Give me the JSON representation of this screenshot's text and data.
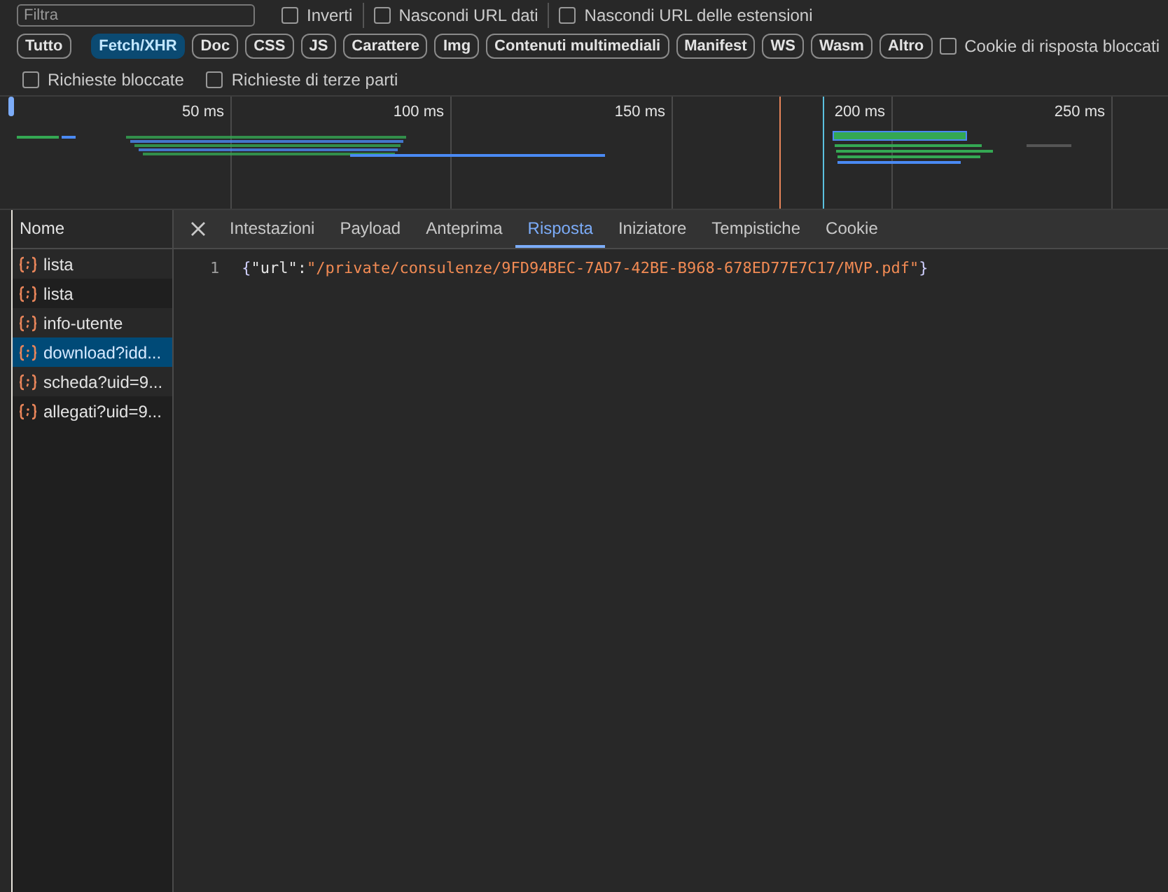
{
  "filter": {
    "placeholder": "Filtra"
  },
  "options_top": [
    {
      "label": "Inverti",
      "checked": false
    },
    {
      "label": "Nascondi URL dati",
      "checked": false
    },
    {
      "label": "Nascondi URL delle estensioni",
      "checked": false
    }
  ],
  "type_filters": [
    {
      "label": "Tutto",
      "selected": false
    },
    {
      "label": "Fetch/XHR",
      "selected": true
    },
    {
      "label": "Doc",
      "selected": false
    },
    {
      "label": "CSS",
      "selected": false
    },
    {
      "label": "JS",
      "selected": false
    },
    {
      "label": "Carattere",
      "selected": false
    },
    {
      "label": "Img",
      "selected": false
    },
    {
      "label": "Contenuti multimediali",
      "selected": false
    },
    {
      "label": "Manifest",
      "selected": false
    },
    {
      "label": "WS",
      "selected": false
    },
    {
      "label": "Wasm",
      "selected": false
    },
    {
      "label": "Altro",
      "selected": false
    }
  ],
  "cookie_filter": {
    "label": "Cookie di risposta bloccati",
    "checked": false
  },
  "options_bottom": [
    {
      "label": "Richieste bloccate",
      "checked": false
    },
    {
      "label": "Richieste di terze parti",
      "checked": false
    }
  ],
  "timeline": {
    "ticks": [
      "50 ms",
      "100 ms",
      "150 ms",
      "200 ms",
      "250 ms"
    ]
  },
  "requests": {
    "column": "Nome",
    "rows": [
      {
        "name": "lista",
        "selected": false
      },
      {
        "name": "lista",
        "selected": false
      },
      {
        "name": "info-utente",
        "selected": false
      },
      {
        "name": "download?idd...",
        "selected": true
      },
      {
        "name": "scheda?uid=9...",
        "selected": false
      },
      {
        "name": "allegati?uid=9...",
        "selected": false
      }
    ]
  },
  "detail": {
    "tabs": [
      {
        "label": "Intestazioni",
        "selected": false
      },
      {
        "label": "Payload",
        "selected": false
      },
      {
        "label": "Anteprima",
        "selected": false
      },
      {
        "label": "Risposta",
        "selected": true
      },
      {
        "label": "Iniziatore",
        "selected": false
      },
      {
        "label": "Tempistiche",
        "selected": false
      },
      {
        "label": "Cookie",
        "selected": false
      }
    ],
    "response": [
      {
        "number": "1",
        "open": "{",
        "key": "\"url\"",
        "sep": ":",
        "value": "\"/private/consulenze/9FD94BEC-7AD7-42BE-B968-678ED77E7C17/MVP.pdf\"",
        "close": "}"
      }
    ]
  }
}
